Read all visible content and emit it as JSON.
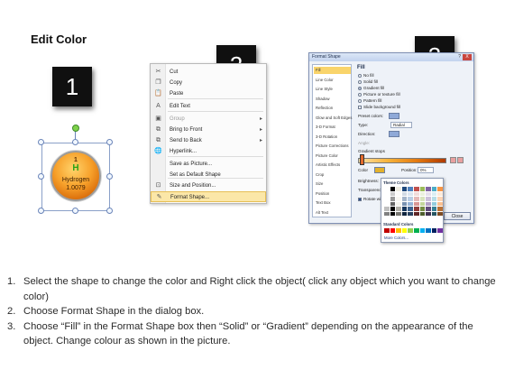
{
  "title": "Edit Color",
  "steps_badges": [
    "1",
    "2",
    "3"
  ],
  "element_shape": {
    "number": "1",
    "symbol": "H",
    "name": "Hydrogen",
    "mass": "1.0079",
    "fill_color": "#f7a12b",
    "symbol_color": "#27a315"
  },
  "context_menu": {
    "items": [
      {
        "label": "Cut",
        "icon": "scissors-icon",
        "glyph": "✂",
        "disabled": false,
        "submenu": false
      },
      {
        "label": "Copy",
        "icon": "copy-icon",
        "glyph": "❐",
        "disabled": false,
        "submenu": false
      },
      {
        "label": "Paste",
        "icon": "paste-icon",
        "glyph": "📋",
        "disabled": false,
        "submenu": false
      },
      {
        "label": "Edit Text",
        "icon": "edit-text-icon",
        "glyph": "A",
        "disabled": false,
        "submenu": false
      },
      {
        "label": "Group",
        "icon": "group-icon",
        "glyph": "▣",
        "disabled": true,
        "submenu": true
      },
      {
        "label": "Bring to Front",
        "icon": "bring-front-icon",
        "glyph": "⧉",
        "disabled": false,
        "submenu": true
      },
      {
        "label": "Send to Back",
        "icon": "send-back-icon",
        "glyph": "⧉",
        "disabled": false,
        "submenu": true
      },
      {
        "label": "Hyperlink...",
        "icon": "hyperlink-icon",
        "glyph": "🌐",
        "disabled": false,
        "submenu": false
      },
      {
        "label": "Save as Picture...",
        "icon": "",
        "glyph": "",
        "disabled": false,
        "submenu": false
      },
      {
        "label": "Set as Default Shape",
        "icon": "",
        "glyph": "",
        "disabled": false,
        "submenu": false
      },
      {
        "label": "Size and Position...",
        "icon": "size-position-icon",
        "glyph": "⊡",
        "disabled": false,
        "submenu": false
      },
      {
        "label": "Format Shape...",
        "icon": "format-shape-icon",
        "glyph": "✎",
        "disabled": false,
        "submenu": false,
        "highlight": true
      }
    ],
    "submenu_arrow": "▸"
  },
  "dialog": {
    "title": "Format Shape",
    "help": "?",
    "close_x": "X",
    "categories": [
      "Fill",
      "Line Color",
      "Line Style",
      "Shadow",
      "Reflection",
      "Glow and Soft Edges",
      "3-D Format",
      "3-D Rotation",
      "Picture Corrections",
      "Picture Color",
      "Artistic Effects",
      "Crop",
      "Size",
      "Position",
      "Text Box",
      "Alt Text"
    ],
    "selected_category": "Fill",
    "heading": "Fill",
    "fill_options": [
      {
        "label": "No fill",
        "checked": false
      },
      {
        "label": "Solid fill",
        "checked": false
      },
      {
        "label": "Gradient fill",
        "checked": true
      },
      {
        "label": "Picture or texture fill",
        "checked": false
      },
      {
        "label": "Pattern fill",
        "checked": false
      }
    ],
    "slide_background": "Slide background fill",
    "preset_colors_label": "Preset colors:",
    "type_label": "Type:",
    "type_value": "Radial",
    "direction_label": "Direction:",
    "angle_label": "Angle:",
    "gradient_stops_label": "Gradient stops",
    "color_label": "Color",
    "position_label": "Position:",
    "position_value": "0%",
    "brightness_label": "Brightness:",
    "transparency_label": "Transparency:",
    "rotate_label": "Rotate with shape",
    "close_button": "Close"
  },
  "palette": {
    "theme_header": "Theme Colors",
    "standard_header": "Standard Colors",
    "more_colors": "More Colors...",
    "theme_top": [
      "#ffffff",
      "#000000",
      "#eeece1",
      "#1f497d",
      "#4f81bd",
      "#c0504d",
      "#9bbb59",
      "#8064a2",
      "#4bacc6",
      "#f79646"
    ],
    "standard": [
      "#c00000",
      "#ff0000",
      "#ffc000",
      "#ffff00",
      "#92d050",
      "#00b050",
      "#00b0f0",
      "#0070c0",
      "#002060",
      "#7030a0"
    ]
  },
  "instructions": [
    {
      "n": "1.",
      "text": "Select the shape to change the color and Right click the object( click any object which you want to change color)"
    },
    {
      "n": "2.",
      "text": "Choose Format Shape in the dialog box."
    },
    {
      "n": "3.",
      "text": "Choose “Fill” in the Format Shape box then “Solid” or “Gradient” depending on the appearance of the object. Change colour as shown in the picture."
    }
  ]
}
